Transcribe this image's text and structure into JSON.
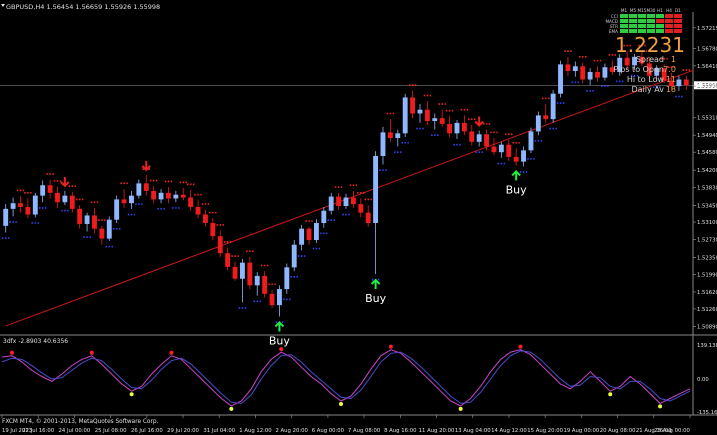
{
  "window": {
    "symbol_header": "GBPUSD,H4  1.56454 1.56659 1.55926 1.55998",
    "copyright": "FXCM MT4, © 2001-2013, MetaQuotes Software Corp."
  },
  "dashboard": {
    "indicator_rows": [
      "CCI",
      "MACD",
      "STR",
      "EMA"
    ],
    "timeframes": [
      "M1",
      "M5",
      "M15",
      "M30",
      "H1",
      "H4",
      "D1"
    ],
    "big_price": "1.2231",
    "stats": [
      {
        "label": "Spread",
        "value": "1"
      },
      {
        "label": "Pips to Open",
        "value": "7.0"
      },
      {
        "label": "Hi to Low",
        "value": "11"
      },
      {
        "label": "Daily Av",
        "value": "18"
      }
    ],
    "colors": {
      "green": "#2ecc40",
      "red": "#e02020",
      "text": "#d0d0d0",
      "big": "#f0a040"
    }
  },
  "chart_data": [
    {
      "type": "candlestick",
      "title": "GBPUSD,H4",
      "ylim": [
        1.5075,
        1.5755
      ],
      "y_ticks": [
        "1.57215",
        "1.56780",
        "1.56410",
        "1.55998",
        "1.55980",
        "1.55310",
        "1.54940",
        "1.54580",
        "1.54200",
        "1.53830",
        "1.53450",
        "1.53100",
        "1.52730",
        "1.52350",
        "1.51990",
        "1.51620",
        "1.51260",
        "1.50890"
      ],
      "current_price": "1.55998",
      "x_ticks": [
        "19 Jul 2013",
        "22 Jul 16:00",
        "24 Jul 00:00",
        "25 Jul 08:00",
        "26 Jul 16:00",
        "29 Jul 20:00",
        "31 Jul 04:00",
        "1 Aug 12:00",
        "2 Aug 20:00",
        "6 Aug 00:00",
        "7 Aug 08:00",
        "8 Aug 16:00",
        "11 Aug 20:00",
        "13 Aug 04:00",
        "14 Aug 12:00",
        "15 Aug 20:00",
        "19 Aug 00:00",
        "20 Aug 08:00",
        "21 Aug 16:00",
        "23 Aug 00:00"
      ],
      "candles": [
        [
          1.5302,
          1.5348,
          1.5288,
          1.5338
        ],
        [
          1.5338,
          1.5362,
          1.5322,
          1.535
        ],
        [
          1.535,
          1.5365,
          1.533,
          1.5342
        ],
        [
          1.5342,
          1.536,
          1.5318,
          1.5326
        ],
        [
          1.5326,
          1.5372,
          1.532,
          1.5366
        ],
        [
          1.5366,
          1.5398,
          1.5352,
          1.5388
        ],
        [
          1.5388,
          1.54,
          1.536,
          1.5372
        ],
        [
          1.5372,
          1.5385,
          1.534,
          1.5352
        ],
        [
          1.5352,
          1.5376,
          1.5346,
          1.5366
        ],
        [
          1.5366,
          1.5374,
          1.533,
          1.5338
        ],
        [
          1.5338,
          1.5346,
          1.5296,
          1.5306
        ],
        [
          1.5306,
          1.533,
          1.529,
          1.5324
        ],
        [
          1.5324,
          1.534,
          1.5286,
          1.5296
        ],
        [
          1.5296,
          1.5302,
          1.5262,
          1.5275
        ],
        [
          1.5275,
          1.5322,
          1.527,
          1.5315
        ],
        [
          1.5315,
          1.5366,
          1.5308,
          1.5358
        ],
        [
          1.5358,
          1.538,
          1.534,
          1.535
        ],
        [
          1.535,
          1.5376,
          1.5338,
          1.5366
        ],
        [
          1.5366,
          1.54,
          1.536,
          1.5392
        ],
        [
          1.5392,
          1.541,
          1.5366,
          1.5376
        ],
        [
          1.5376,
          1.5386,
          1.535,
          1.5358
        ],
        [
          1.5358,
          1.538,
          1.535,
          1.5372
        ],
        [
          1.5372,
          1.5384,
          1.535,
          1.536
        ],
        [
          1.536,
          1.5376,
          1.5352,
          1.5368
        ],
        [
          1.5368,
          1.5382,
          1.5356,
          1.5362
        ],
        [
          1.5362,
          1.5378,
          1.5334,
          1.5342
        ],
        [
          1.5342,
          1.5356,
          1.5318,
          1.5326
        ],
        [
          1.5326,
          1.5336,
          1.53,
          1.5308
        ],
        [
          1.5308,
          1.5318,
          1.5272,
          1.528
        ],
        [
          1.528,
          1.5292,
          1.5236,
          1.5244
        ],
        [
          1.5244,
          1.5256,
          1.5208,
          1.5215
        ],
        [
          1.5215,
          1.5226,
          1.5186,
          1.519
        ],
        [
          1.519,
          1.5232,
          1.514,
          1.5224
        ],
        [
          1.5224,
          1.5236,
          1.5168,
          1.5176
        ],
        [
          1.5176,
          1.5204,
          1.5154,
          1.5196
        ],
        [
          1.5196,
          1.5206,
          1.515,
          1.5158
        ],
        [
          1.5158,
          1.5166,
          1.5128,
          1.5134
        ],
        [
          1.5134,
          1.5176,
          1.511,
          1.5168
        ],
        [
          1.5168,
          1.5222,
          1.5158,
          1.5214
        ],
        [
          1.5214,
          1.5272,
          1.5206,
          1.5262
        ],
        [
          1.5262,
          1.5304,
          1.525,
          1.5296
        ],
        [
          1.5296,
          1.53,
          1.5262,
          1.5272
        ],
        [
          1.5272,
          1.5316,
          1.5266,
          1.5308
        ],
        [
          1.5308,
          1.5342,
          1.5298,
          1.5334
        ],
        [
          1.5334,
          1.5372,
          1.5326,
          1.5364
        ],
        [
          1.5364,
          1.5372,
          1.5336,
          1.5344
        ],
        [
          1.5344,
          1.537,
          1.5338,
          1.5362
        ],
        [
          1.5362,
          1.5376,
          1.534,
          1.5348
        ],
        [
          1.5348,
          1.536,
          1.532,
          1.533
        ],
        [
          1.533,
          1.5346,
          1.53,
          1.5308
        ],
        [
          1.5308,
          1.546,
          1.52,
          1.545
        ],
        [
          1.545,
          1.5512,
          1.5432,
          1.55
        ],
        [
          1.55,
          1.5528,
          1.548,
          1.5488
        ],
        [
          1.5488,
          1.5506,
          1.547,
          1.5498
        ],
        [
          1.5498,
          1.5582,
          1.549,
          1.5574
        ],
        [
          1.5574,
          1.5588,
          1.553,
          1.554
        ],
        [
          1.554,
          1.556,
          1.552,
          1.5548
        ],
        [
          1.5548,
          1.5566,
          1.5516,
          1.5524
        ],
        [
          1.5524,
          1.554,
          1.5506,
          1.553
        ],
        [
          1.553,
          1.5548,
          1.5512,
          1.5518
        ],
        [
          1.5518,
          1.5534,
          1.549,
          1.5498
        ],
        [
          1.5498,
          1.5526,
          1.5486,
          1.552
        ],
        [
          1.552,
          1.5536,
          1.5494,
          1.5502
        ],
        [
          1.5502,
          1.5516,
          1.5472,
          1.548
        ],
        [
          1.548,
          1.5504,
          1.547,
          1.5496
        ],
        [
          1.5496,
          1.5506,
          1.5462,
          1.547
        ],
        [
          1.547,
          1.5488,
          1.5452,
          1.5458
        ],
        [
          1.5458,
          1.548,
          1.5446,
          1.5474
        ],
        [
          1.5474,
          1.5484,
          1.544,
          1.5448
        ],
        [
          1.5448,
          1.5466,
          1.543,
          1.5438
        ],
        [
          1.5438,
          1.547,
          1.5428,
          1.5462
        ],
        [
          1.5462,
          1.551,
          1.5456,
          1.5502
        ],
        [
          1.5502,
          1.5544,
          1.5494,
          1.5536
        ],
        [
          1.5536,
          1.556,
          1.552,
          1.5528
        ],
        [
          1.5528,
          1.559,
          1.552,
          1.5582
        ],
        [
          1.5582,
          1.5652,
          1.5574,
          1.5644
        ],
        [
          1.5644,
          1.566,
          1.562,
          1.563
        ],
        [
          1.563,
          1.565,
          1.5618,
          1.564
        ],
        [
          1.564,
          1.5648,
          1.5604,
          1.5612
        ],
        [
          1.5612,
          1.5636,
          1.56,
          1.5628
        ],
        [
          1.5628,
          1.564,
          1.5608,
          1.5616
        ],
        [
          1.5616,
          1.5646,
          1.561,
          1.5638
        ],
        [
          1.5638,
          1.5652,
          1.5622,
          1.5628
        ],
        [
          1.5628,
          1.5666,
          1.562,
          1.5658
        ],
        [
          1.5658,
          1.5672,
          1.5634,
          1.5642
        ],
        [
          1.5642,
          1.5666,
          1.5632,
          1.566
        ],
        [
          1.566,
          1.5672,
          1.564,
          1.5646
        ],
        [
          1.5646,
          1.566,
          1.5612,
          1.562
        ],
        [
          1.562,
          1.5642,
          1.5608,
          1.5636
        ],
        [
          1.5636,
          1.5644,
          1.5604,
          1.561
        ],
        [
          1.561,
          1.5626,
          1.559,
          1.5598
        ],
        [
          1.5598,
          1.562,
          1.5588,
          1.5612
        ],
        [
          1.5612,
          1.562,
          1.559,
          1.56
        ]
      ],
      "trendline": {
        "from": [
          0,
          1.509
        ],
        "to": [
          93,
          1.5632
        ]
      },
      "signals": [
        {
          "label": "Buy",
          "index": 37,
          "price": 1.511
        },
        {
          "label": "Buy",
          "index": 50,
          "price": 1.52
        },
        {
          "label": "Buy",
          "index": 69,
          "price": 1.543
        }
      ],
      "down_arrows": [
        8,
        19,
        64
      ]
    },
    {
      "type": "line",
      "title": "3dfx -2.8903 40.6356",
      "ylim": [
        -135.16,
        139.13
      ],
      "y_ticks": [
        "139.138",
        "0.00",
        "-135.16"
      ],
      "series": [
        {
          "name": "",
          "color": "#cc44cc",
          "values": [
            90,
            95,
            70,
            35,
            10,
            -10,
            20,
            55,
            80,
            95,
            60,
            20,
            -20,
            -50,
            -30,
            20,
            60,
            95,
            80,
            40,
            0,
            -40,
            -80,
            -110,
            -90,
            -40,
            30,
            80,
            110,
            90,
            50,
            10,
            -20,
            -60,
            -90,
            -70,
            -20,
            40,
            95,
            120,
            105,
            70,
            30,
            -10,
            -50,
            -90,
            -110,
            -80,
            -30,
            30,
            80,
            110,
            120,
            100,
            60,
            20,
            -20,
            -40,
            -10,
            30,
            -10,
            -50,
            -30,
            10,
            -20,
            -60,
            -100,
            -80,
            -60,
            -40
          ]
        },
        {
          "name": "",
          "color": "#4b4bcc",
          "values": [
            70,
            85,
            80,
            55,
            25,
            0,
            5,
            35,
            65,
            85,
            75,
            40,
            0,
            -35,
            -40,
            -5,
            40,
            75,
            85,
            60,
            20,
            -20,
            -60,
            -95,
            -100,
            -65,
            0,
            55,
            95,
            100,
            70,
            30,
            -5,
            -40,
            -75,
            -80,
            -45,
            10,
            70,
            105,
            110,
            85,
            50,
            10,
            -30,
            -70,
            -100,
            -95,
            -55,
            0,
            55,
            95,
            115,
            110,
            80,
            40,
            0,
            -30,
            -25,
            10,
            5,
            -30,
            -40,
            -10,
            -10,
            -40,
            -80,
            -90,
            -70,
            -50
          ]
        }
      ]
    }
  ]
}
